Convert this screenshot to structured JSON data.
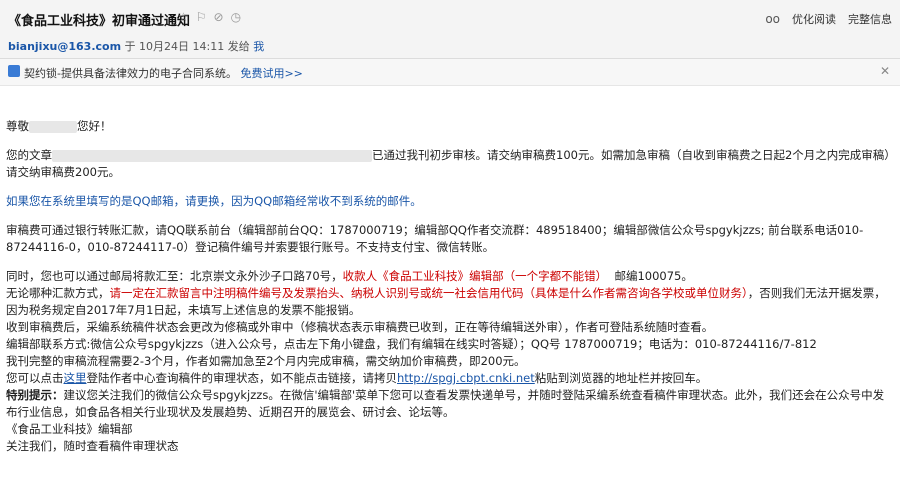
{
  "mail": {
    "subject": "《食品工业科技》初审通过通知",
    "sender": "bianjixu@163.com",
    "date_prefix": "于",
    "date": "10月24日 14:11",
    "send_to_label": "发给",
    "recipient": "我",
    "optimize_read": "优化阅读",
    "full_info": "完整信息"
  },
  "ad": {
    "text": "契约锁-提供具备法律效力的电子合同系统。",
    "cta": "免费试用>>"
  },
  "content": {
    "greeting_a": "尊敬",
    "greeting_b": "您好！",
    "p1_a": "您的文章",
    "p1_b": "已通过我刊初步审核。请交纳审稿费100元。如需加急审稿（自收到审稿费之日起2个月之内完成审稿）请交纳审稿费200元。",
    "p2": "如果您在系统里填写的是QQ邮箱，请更换，因为QQ邮箱经常收不到系统的邮件。",
    "p3": "审稿费可通过银行转账汇款，请QQ联系前台（编辑部前台QQ：1787000719；编辑部QQ作者交流群：489518400；编辑部微信公众号spgykjzzs; 前台联系电话010-87244116-0，010-87244117-0）登记稿件编号并索要银行账号。不支持支付宝、微信转账。",
    "p4_a": "同时，您也可以通过邮局将款汇至：北京崇文永外沙子口路70号，",
    "p4_b": "收款人《食品工业科技》编辑部（一个字都不能错）",
    "p4_c": "邮编100075。",
    "p5_a": "无论哪种汇款方式，",
    "p5_b": "请一定在汇款留言中注明稿件编号及发票抬头、纳税人识别号或统一社会信用代码（具体是什么作者需咨询各学校或单位财务）",
    "p5_c": "，否则我们无法开据发票，因为税务规定自2017年7月1日起，未填写上述信息的发票不能报销。",
    "p6": "收到审稿费后，采编系统稿件状态会更改为修稿或外审中（修稿状态表示审稿费已收到，正在等待编辑送外审），作者可登陆系统随时查看。",
    "p7": "编辑部联系方式:微信公众号spgykjzzs（进入公众号，点击左下角小键盘，我们有编辑在线实时答疑）；QQ号 1787000719；电话为：010-87244116/7-812",
    "p8": "我刊完整的审稿流程需要2-3个月，作者如需加急至2个月内完成审稿，需交纳加价审稿费，即200元。",
    "p9_a": "您可以点击",
    "p9_link1": "这里",
    "p9_b": "登陆作者中心查询稿件的审理状态，如不能点击链接，请拷贝",
    "p9_link2": "http://spgj.cbpt.cnki.net",
    "p9_c": "粘贴到浏览器的地址栏并按回车。",
    "p10_bold": "特别提示：",
    "p10": "建议您关注我们的微信公众号spgykjzzs。在微信'编辑部'菜单下您可以查看发票快递单号，并随时登陆采编系统查看稿件审理状态。此外，我们还会在公众号中发布行业信息，如食品各相关行业现状及发展趋势、近期召开的展览会、研讨会、论坛等。",
    "p11": "《食品工业科技》编辑部",
    "p12": "关注我们，随时查看稿件审理状态"
  }
}
